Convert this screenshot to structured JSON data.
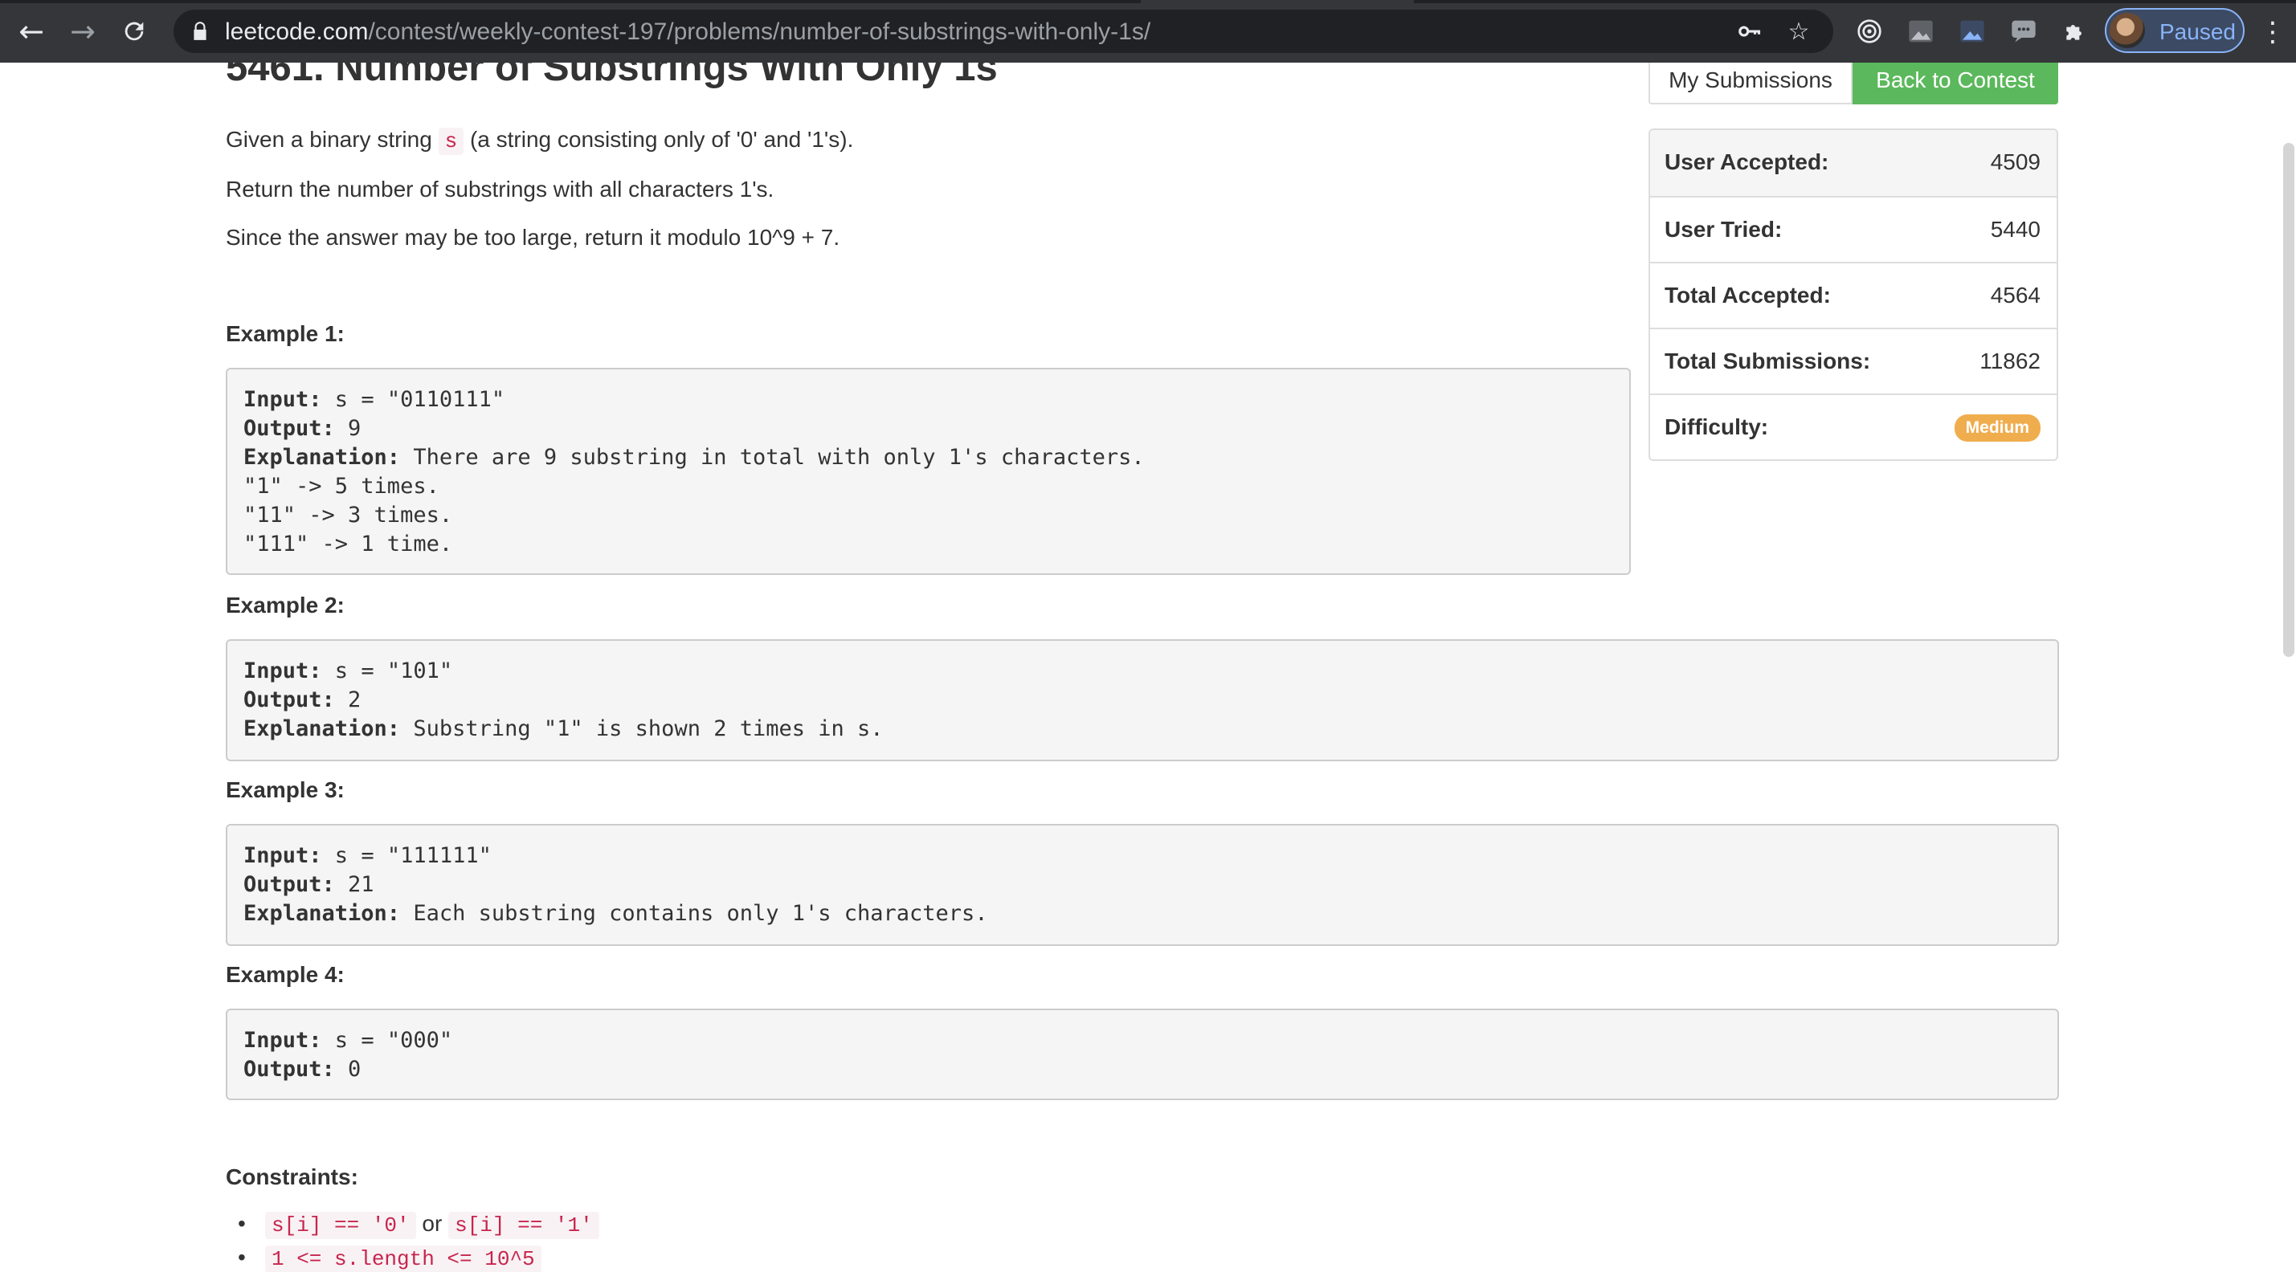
{
  "browser": {
    "url_host": "leetcode.com",
    "url_path": "/contest/weekly-contest-197/problems/number-of-substrings-with-only-1s/",
    "profile_status": "Paused"
  },
  "problem": {
    "title": "5461. Number of Substrings With Only 1s",
    "desc1_pre": "Given a binary string ",
    "desc1_code": "s",
    "desc1_post": " (a string consisting only of '0' and '1's).",
    "desc2": "Return the number of substrings with all characters 1's.",
    "desc3": "Since the answer may be too large, return it modulo 10^9 + 7."
  },
  "examples": [
    {
      "title": "Example 1:",
      "input_label": "Input:",
      "input": " s = \"0110111\"",
      "output_label": "Output:",
      "output": " 9",
      "explanation_label": "Explanation:",
      "explanation": " There are 9 substring in total with only 1's characters.",
      "extra1": "\"1\" -> 5 times.",
      "extra2": "\"11\" -> 3 times.",
      "extra3": "\"111\" -> 1 time."
    },
    {
      "title": "Example 2:",
      "input_label": "Input:",
      "input": " s = \"101\"",
      "output_label": "Output:",
      "output": " 2",
      "explanation_label": "Explanation:",
      "explanation": " Substring \"1\" is shown 2 times in s."
    },
    {
      "title": "Example 3:",
      "input_label": "Input:",
      "input": " s = \"111111\"",
      "output_label": "Output:",
      "output": " 21",
      "explanation_label": "Explanation:",
      "explanation": " Each substring contains only 1's characters."
    },
    {
      "title": "Example 4:",
      "input_label": "Input:",
      "input": " s = \"000\"",
      "output_label": "Output:",
      "output": " 0"
    }
  ],
  "constraints": {
    "title": "Constraints:",
    "c1_a": "s[i] == '0'",
    "c1_or": " or ",
    "c1_b": "s[i] == '1'",
    "c2": "1 <= s.length <= 10^5"
  },
  "sidebar": {
    "my_submissions": "My Submissions",
    "back_to_contest": "Back to Contest",
    "stats": [
      {
        "label": "User Accepted:",
        "value": "4509"
      },
      {
        "label": "User Tried:",
        "value": "5440"
      },
      {
        "label": "Total Accepted:",
        "value": "4564"
      },
      {
        "label": "Total Submissions:",
        "value": "11862"
      },
      {
        "label": "Difficulty:",
        "value": "Medium"
      }
    ],
    "difficulty_color": "#f0ad4e",
    "accent_green": "#5cb85c"
  }
}
